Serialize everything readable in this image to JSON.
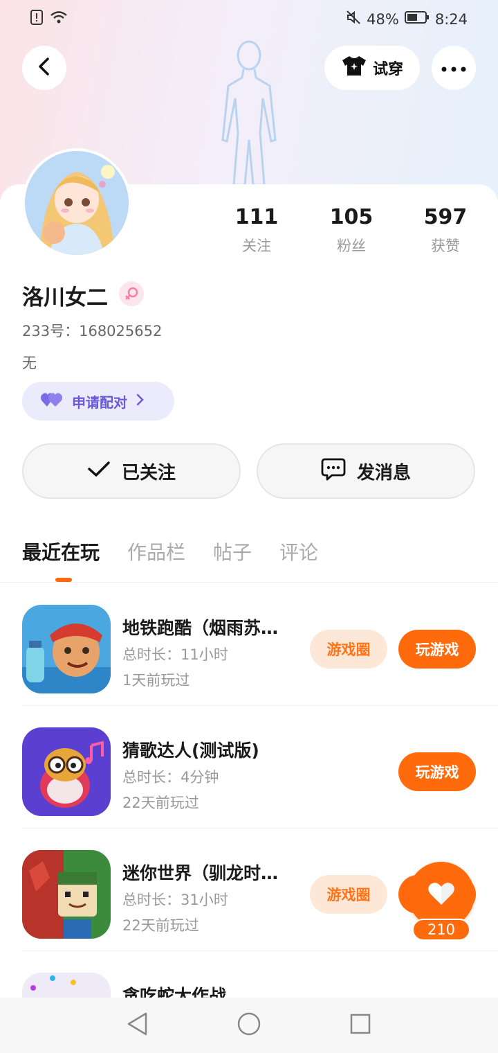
{
  "status_bar": {
    "battery_percent": "48%",
    "time": "8:24"
  },
  "header": {
    "tryon_label": "试穿"
  },
  "profile": {
    "name": "洛川女二",
    "uid_label": "233号：",
    "uid": "168025652",
    "bio": "无",
    "pair_label": "申请配对",
    "stats": [
      {
        "value": "111",
        "label": "关注"
      },
      {
        "value": "105",
        "label": "粉丝"
      },
      {
        "value": "597",
        "label": "获赞"
      }
    ],
    "follow_label": "已关注",
    "message_label": "发消息"
  },
  "tabs": [
    {
      "label": "最近在玩",
      "active": true
    },
    {
      "label": "作品栏",
      "active": false
    },
    {
      "label": "帖子",
      "active": false
    },
    {
      "label": "评论",
      "active": false
    }
  ],
  "games": [
    {
      "title": "地铁跑酷（烟雨苏…",
      "duration": "总时长：11小时",
      "last_played": "1天前玩过",
      "circle_label": "游戏圈",
      "play_label": "玩游戏"
    },
    {
      "title": "猜歌达人(测试版)",
      "duration": "总时长：4分钟",
      "last_played": "22天前玩过",
      "play_label": "玩游戏"
    },
    {
      "title": "迷你世界（驯龙时…",
      "duration": "总时长：31小时",
      "last_played": "22天前玩过",
      "circle_label": "游戏圈",
      "play_label": "玩游戏"
    },
    {
      "title": "贪吃蛇大作战"
    }
  ],
  "like_fab": {
    "count": "210"
  },
  "colors": {
    "accent": "#ff6a0c",
    "pair_purple": "#6a5ad8"
  }
}
